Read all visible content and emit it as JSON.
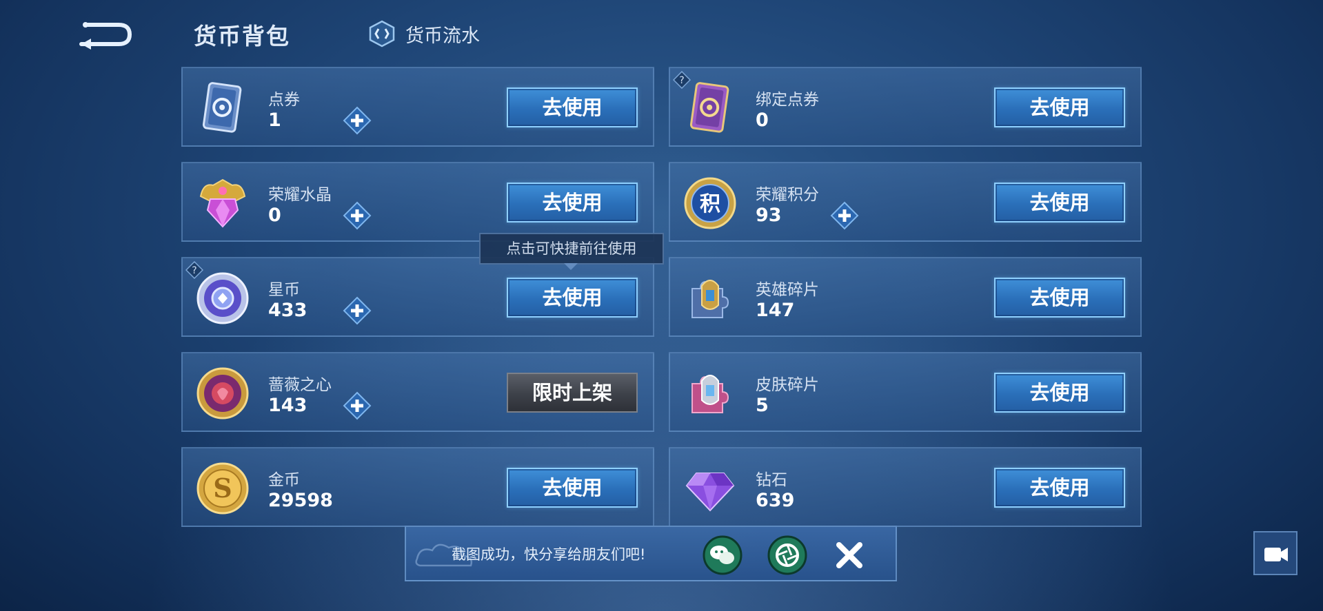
{
  "header": {
    "title": "货币背包",
    "flow_tab_label": "货币流水"
  },
  "left_items": [
    {
      "name": "点券",
      "amount": "1",
      "action": "去使用",
      "icon": "ticket-icon"
    },
    {
      "name": "荣耀水晶",
      "amount": "0",
      "action": "去使用",
      "icon": "crystal-icon"
    },
    {
      "name": "星币",
      "amount": "433",
      "action": "去使用",
      "icon": "star-coin-icon"
    },
    {
      "name": "蔷薇之心",
      "amount": "143",
      "action": "限时上架",
      "icon": "rose-heart-icon"
    },
    {
      "name": "金币",
      "amount": "29598",
      "action": "去使用",
      "icon": "gold-coin-icon"
    }
  ],
  "right_items": [
    {
      "name": "绑定点券",
      "amount": "0",
      "action": "去使用",
      "icon": "bound-ticket-icon"
    },
    {
      "name": "荣耀积分",
      "amount": "93",
      "action": "去使用",
      "icon": "glory-points-icon"
    },
    {
      "name": "英雄碎片",
      "amount": "147",
      "action": "去使用",
      "icon": "hero-fragment-icon"
    },
    {
      "name": "皮肤碎片",
      "amount": "5",
      "action": "去使用",
      "icon": "skin-fragment-icon"
    },
    {
      "name": "钻石",
      "amount": "639",
      "action": "去使用",
      "icon": "diamond-icon"
    }
  ],
  "tooltip": "点击可快捷前往使用",
  "share_bar": {
    "message": "截图成功，快分享给朋友们吧!"
  },
  "colors": {
    "button_blue": "#2a6fb9",
    "button_border": "#8fd0ff",
    "background": "#1f4677"
  }
}
